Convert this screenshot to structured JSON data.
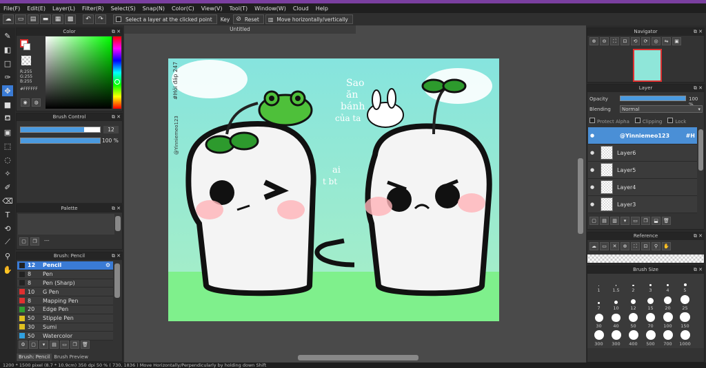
{
  "menu": [
    "File(F)",
    "Edit(E)",
    "Layer(L)",
    "Filter(R)",
    "Select(S)",
    "Snap(N)",
    "Color(C)",
    "View(V)",
    "Tool(T)",
    "Window(W)",
    "Cloud",
    "Help"
  ],
  "toolbar": {
    "select_layer": "Select a layer at the clicked point",
    "key_label": "Key",
    "reset_label": "Reset",
    "move_label": "Move horizontally/vertically"
  },
  "color_panel": {
    "title": "Color",
    "r": "R:255",
    "g": "G:255",
    "b": "B:255",
    "hex": "#FFFFFF"
  },
  "brush_control": {
    "title": "Brush Control",
    "size": "12",
    "opacity": "100 %",
    "size_fill": 0.8,
    "opacity_fill": 1.0
  },
  "palette": {
    "title": "Palette",
    "dots": "---"
  },
  "brush_panel": {
    "title": "Brush: Pencil",
    "items": [
      {
        "size": "12",
        "name": "Pencil",
        "color": "#222222"
      },
      {
        "size": "8",
        "name": "Pen",
        "color": "#222222"
      },
      {
        "size": "8",
        "name": "Pen (Sharp)",
        "color": "#222222"
      },
      {
        "size": "10",
        "name": "G Pen",
        "color": "#e03030"
      },
      {
        "size": "8",
        "name": "Mapping Pen",
        "color": "#e03030"
      },
      {
        "size": "20",
        "name": "Edge Pen",
        "color": "#30a030"
      },
      {
        "size": "50",
        "name": "Stipple Pen",
        "color": "#e0c020"
      },
      {
        "size": "30",
        "name": "Sumi",
        "color": "#e0c020"
      },
      {
        "size": "50",
        "name": "Watercolor",
        "color": "#30a0e0"
      }
    ],
    "tab1": "Brush: Pencil",
    "tab2": "Brush Preview"
  },
  "document": {
    "title": "Untitled"
  },
  "artwork": {
    "watermark1": "#Hỏi đáp 247",
    "watermark2": "@Yinniemeo123",
    "text1": "Sao",
    "text2": "ăn",
    "text3": "bánh",
    "text4": "của ta",
    "text5": "ai",
    "text6": "t bt"
  },
  "navigator": {
    "title": "Navigator"
  },
  "layer_panel": {
    "title": "Layer",
    "opacity_label": "Opacity",
    "opacity_value": "100 %",
    "blending_label": "Blending",
    "blending_value": "Normal",
    "protect_alpha": "Protect Alpha",
    "clipping": "Clipping",
    "lock": "Lock",
    "layers": [
      {
        "name": "@Yinniemeo123",
        "extra": "#H",
        "selected": true
      },
      {
        "name": "Layer6",
        "selected": false
      },
      {
        "name": "Layer5",
        "selected": false
      },
      {
        "name": "Layer4",
        "selected": false
      },
      {
        "name": "Layer3",
        "selected": false
      }
    ]
  },
  "reference": {
    "title": "Reference"
  },
  "brush_size": {
    "title": "Brush Size",
    "sizes": [
      "1",
      "1.5",
      "2",
      "3",
      "4",
      "5",
      "7",
      "10",
      "12",
      "15",
      "20",
      "25",
      "30",
      "40",
      "50",
      "70",
      "100",
      "150",
      "300",
      "300",
      "400",
      "500",
      "700",
      "1000"
    ]
  },
  "status": "1200 * 1500 pixel   (8.7 * 10.9cm)   350 dpi   50 %   ( 730, 1836 )   Move Horizontally/Perpendicularly by holding down Shift"
}
